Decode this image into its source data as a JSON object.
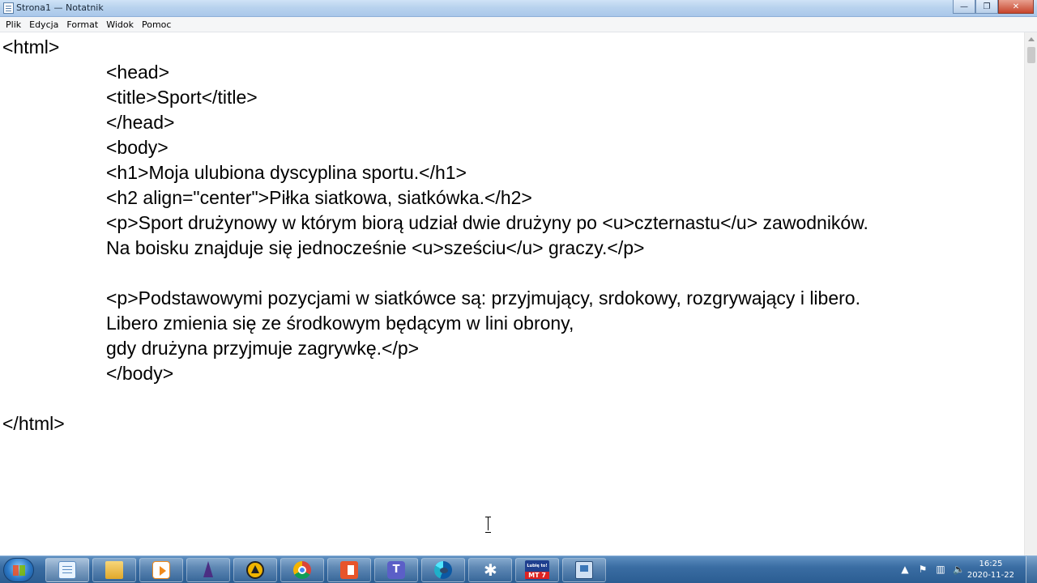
{
  "window": {
    "title": "Strona1 — Notatnik",
    "minimize_label": "—",
    "maximize_label": "❐",
    "close_label": "✕"
  },
  "menu": {
    "items": [
      "Plik",
      "Edycja",
      "Format",
      "Widok",
      "Pomoc"
    ]
  },
  "editor": {
    "lines": [
      "<html>",
      "<head>",
      "<title>Sport</title>",
      "</head>",
      "<body>",
      "<h1>Moja ulubiona dyscyplina sportu.</h1>",
      "<h2 align=\"center\">Piłka siatkowa, siatkówka.</h2>",
      "<p>Sport drużynowy w którym biorą udział dwie drużyny po <u>czternastu</u> zawodników.",
      "Na boisku znajduje się jednocześnie <u>sześciu</u> graczy.</p>",
      "",
      "<p>Podstawowymi pozycjami w siatkówce są: przyjmujący, srdokowy, rozgrywający i libero.",
      "Libero zmienia się ze środkowym będącym w lini obrony,",
      "gdy drużyna przyjmuje zagrywkę.</p>",
      "</body>",
      "",
      "</html>"
    ]
  },
  "taskbar": {
    "apps": [
      {
        "icon": "notepad-icon"
      },
      {
        "icon": "folder-icon"
      },
      {
        "icon": "media-player-icon"
      },
      {
        "icon": "wizard-icon"
      },
      {
        "icon": "triangle-app-icon"
      },
      {
        "icon": "chrome-icon"
      },
      {
        "icon": "office-icon"
      },
      {
        "icon": "teams-icon",
        "label": "T"
      },
      {
        "icon": "edge-icon"
      },
      {
        "icon": "snowflake-app-icon"
      },
      {
        "icon": "mt7-icon",
        "label_top": "Lubię to!",
        "label_bottom": "MT 7"
      },
      {
        "icon": "network-app-icon"
      }
    ],
    "tray": {
      "time": "16:25",
      "date": "2020-11-22",
      "icons": [
        "arrow-up-icon",
        "flag-icon",
        "network-icon",
        "volume-icon"
      ]
    }
  },
  "colors": {
    "taskbar": "#3a6da3",
    "titlebar": "#b9d3ee",
    "close_button": "#c7452c"
  }
}
